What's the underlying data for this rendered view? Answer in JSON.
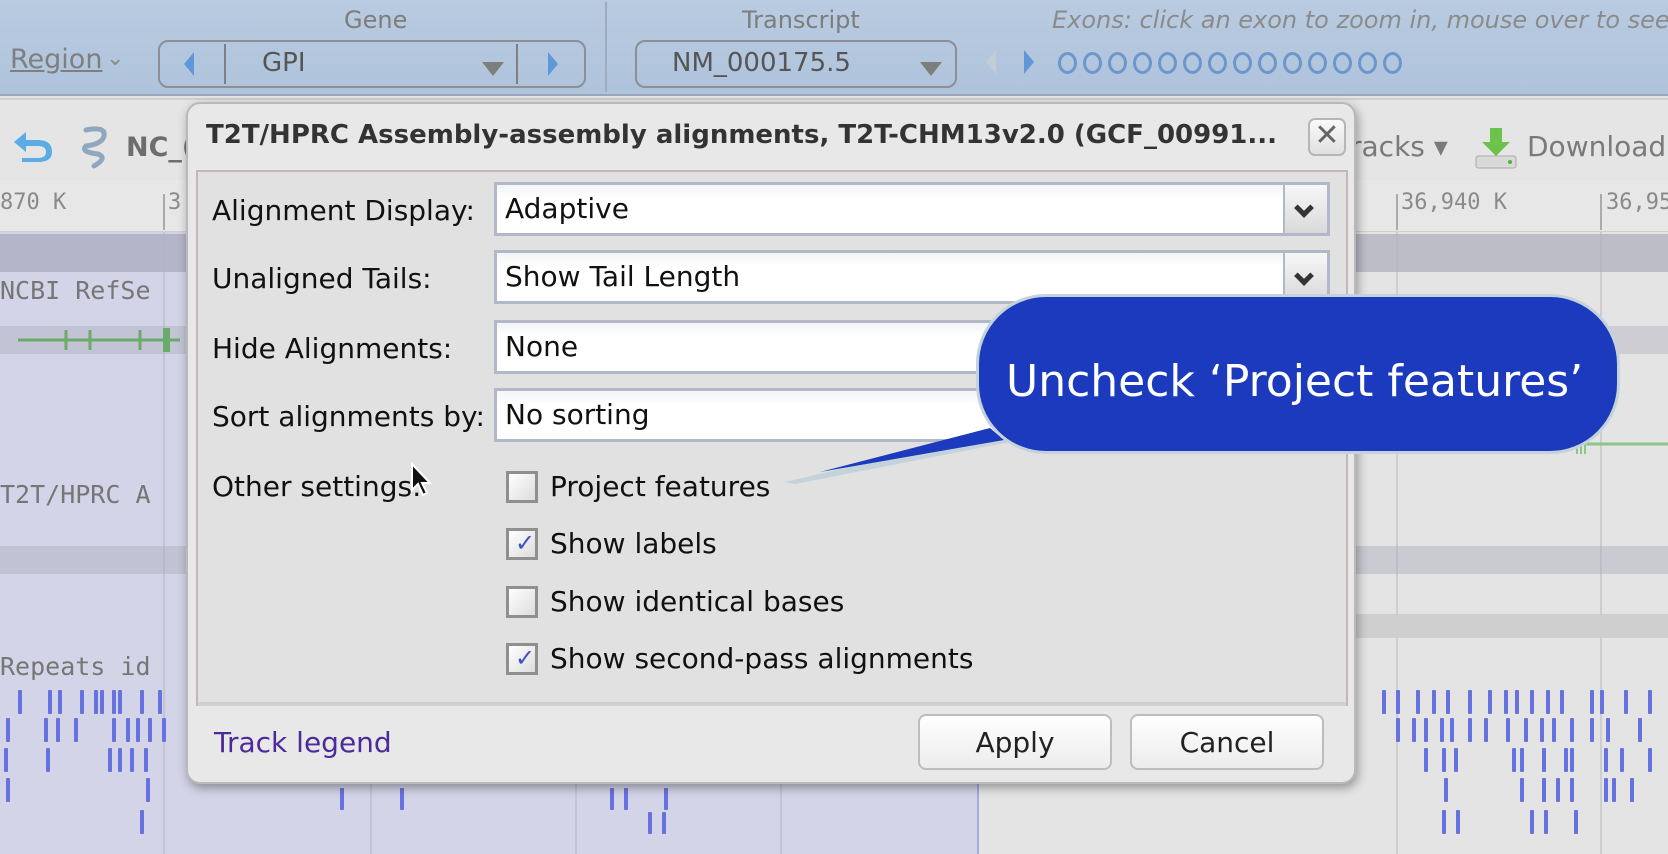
{
  "topbar": {
    "region_label": "Region",
    "gene_label": "Gene",
    "gene_value": "GPI",
    "transcript_label": "Transcript",
    "transcript_value": "NM_000175.5",
    "exons_hint": "Exons: click an exon to zoom in, mouse over to see d",
    "exon_count_visible": 14
  },
  "toolbar": {
    "sequence_label": "NC_(",
    "tracks_label": "racks ▾",
    "download_label": "Download ▾"
  },
  "ruler": {
    "labels": [
      "870 K",
      "3",
      "36,940 K",
      "36,95"
    ]
  },
  "tracks": {
    "labels": [
      "NCBI RefSe",
      "T2T/HPRC A",
      "Repeats id"
    ]
  },
  "dialog": {
    "title": "T2T/HPRC Assembly-assembly alignments, T2T-CHM13v2.0 (GCF_00991...",
    "close_symbol": "✕",
    "fields": [
      {
        "label": "Alignment Display:",
        "value": "Adaptive"
      },
      {
        "label": "Unaligned Tails:",
        "value": "Show Tail Length"
      },
      {
        "label": "Hide Alignments:",
        "value": "None"
      },
      {
        "label": "Sort alignments by:",
        "value": "No sorting"
      }
    ],
    "other_settings_label": "Other settings:",
    "checkboxes": [
      {
        "label": "Project features",
        "checked": false
      },
      {
        "label": "Show labels",
        "checked": true
      },
      {
        "label": "Show identical bases",
        "checked": false
      },
      {
        "label": "Show second-pass alignments",
        "checked": true
      }
    ],
    "check_glyph": "✓",
    "track_legend": "Track legend",
    "apply": "Apply",
    "cancel": "Cancel"
  },
  "callout": {
    "text": "Uncheck ‘Project features’",
    "color": "#1c3abd"
  }
}
